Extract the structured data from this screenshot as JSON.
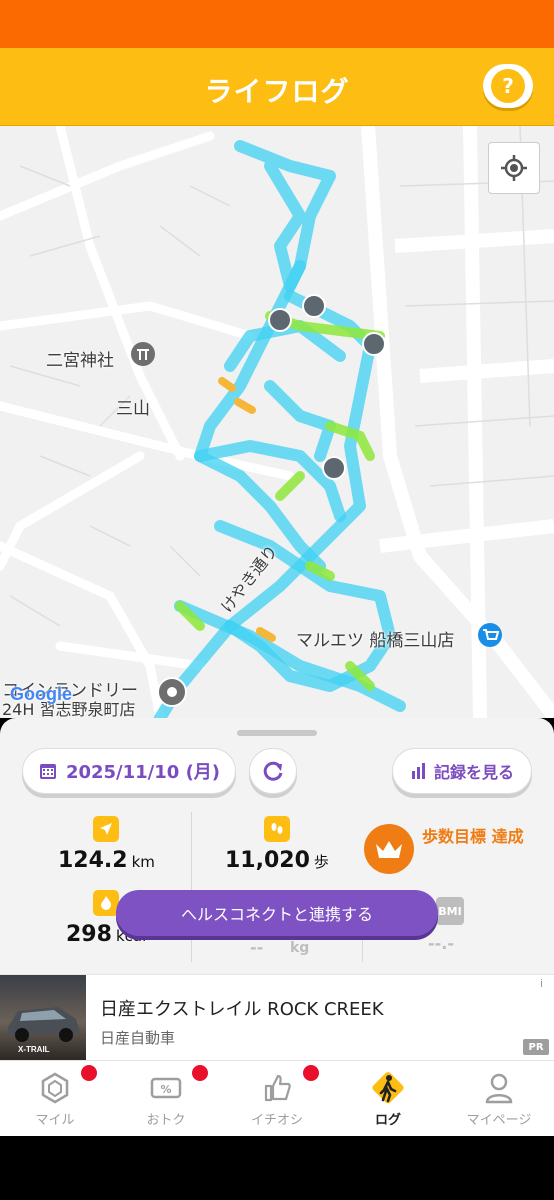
{
  "header": {
    "title": "ライフログ",
    "help_label": "?"
  },
  "map": {
    "labels": {
      "shrine": "二宮神社",
      "mitsuyama": "三山",
      "street": "けやき通り",
      "supermarket": "マルエツ 船橋三山店",
      "laundry_line1": "コインランドリー",
      "laundry_line2": "24H 習志野泉町店"
    },
    "attribution": "Google"
  },
  "panel": {
    "date_label": "2025/11/10 (月)",
    "records_label": "記録を見る",
    "distance": {
      "value": "124.2",
      "unit": "km"
    },
    "steps": {
      "value": "11,020",
      "unit": "歩"
    },
    "goal_text": "歩数目標 達成",
    "calories": {
      "value": "298",
      "unit": "kcal"
    },
    "health_connect_label": "ヘルスコネクトと連携する",
    "bmi_label": "BMI",
    "weight_unit": "kg",
    "weight_placeholder": "--",
    "bmi_placeholder": "--.-"
  },
  "ad": {
    "title": "日産エクストレイル ROCK CREEK",
    "advertiser": "日産自動車",
    "thumb_text": "X-TRAIL",
    "pr_label": "PR",
    "info_label": "i"
  },
  "tabs": [
    {
      "label": "マイル",
      "icon": "hexagon-icon",
      "badge": true
    },
    {
      "label": "おトク",
      "icon": "coupon-icon",
      "badge": true
    },
    {
      "label": "イチオシ",
      "icon": "thumbs-up-icon",
      "badge": true
    },
    {
      "label": "ログ",
      "icon": "walking-person-icon",
      "badge": false,
      "active": true
    },
    {
      "label": "マイページ",
      "icon": "person-icon",
      "badge": false
    }
  ],
  "colors": {
    "status_bar": "#fb6a00",
    "header": "#fdbd12",
    "accent_purple": "#7e52c2",
    "goal_orange": "#f07d13",
    "track_cyan": "#3fd0f3",
    "track_green": "#8ee83a"
  }
}
